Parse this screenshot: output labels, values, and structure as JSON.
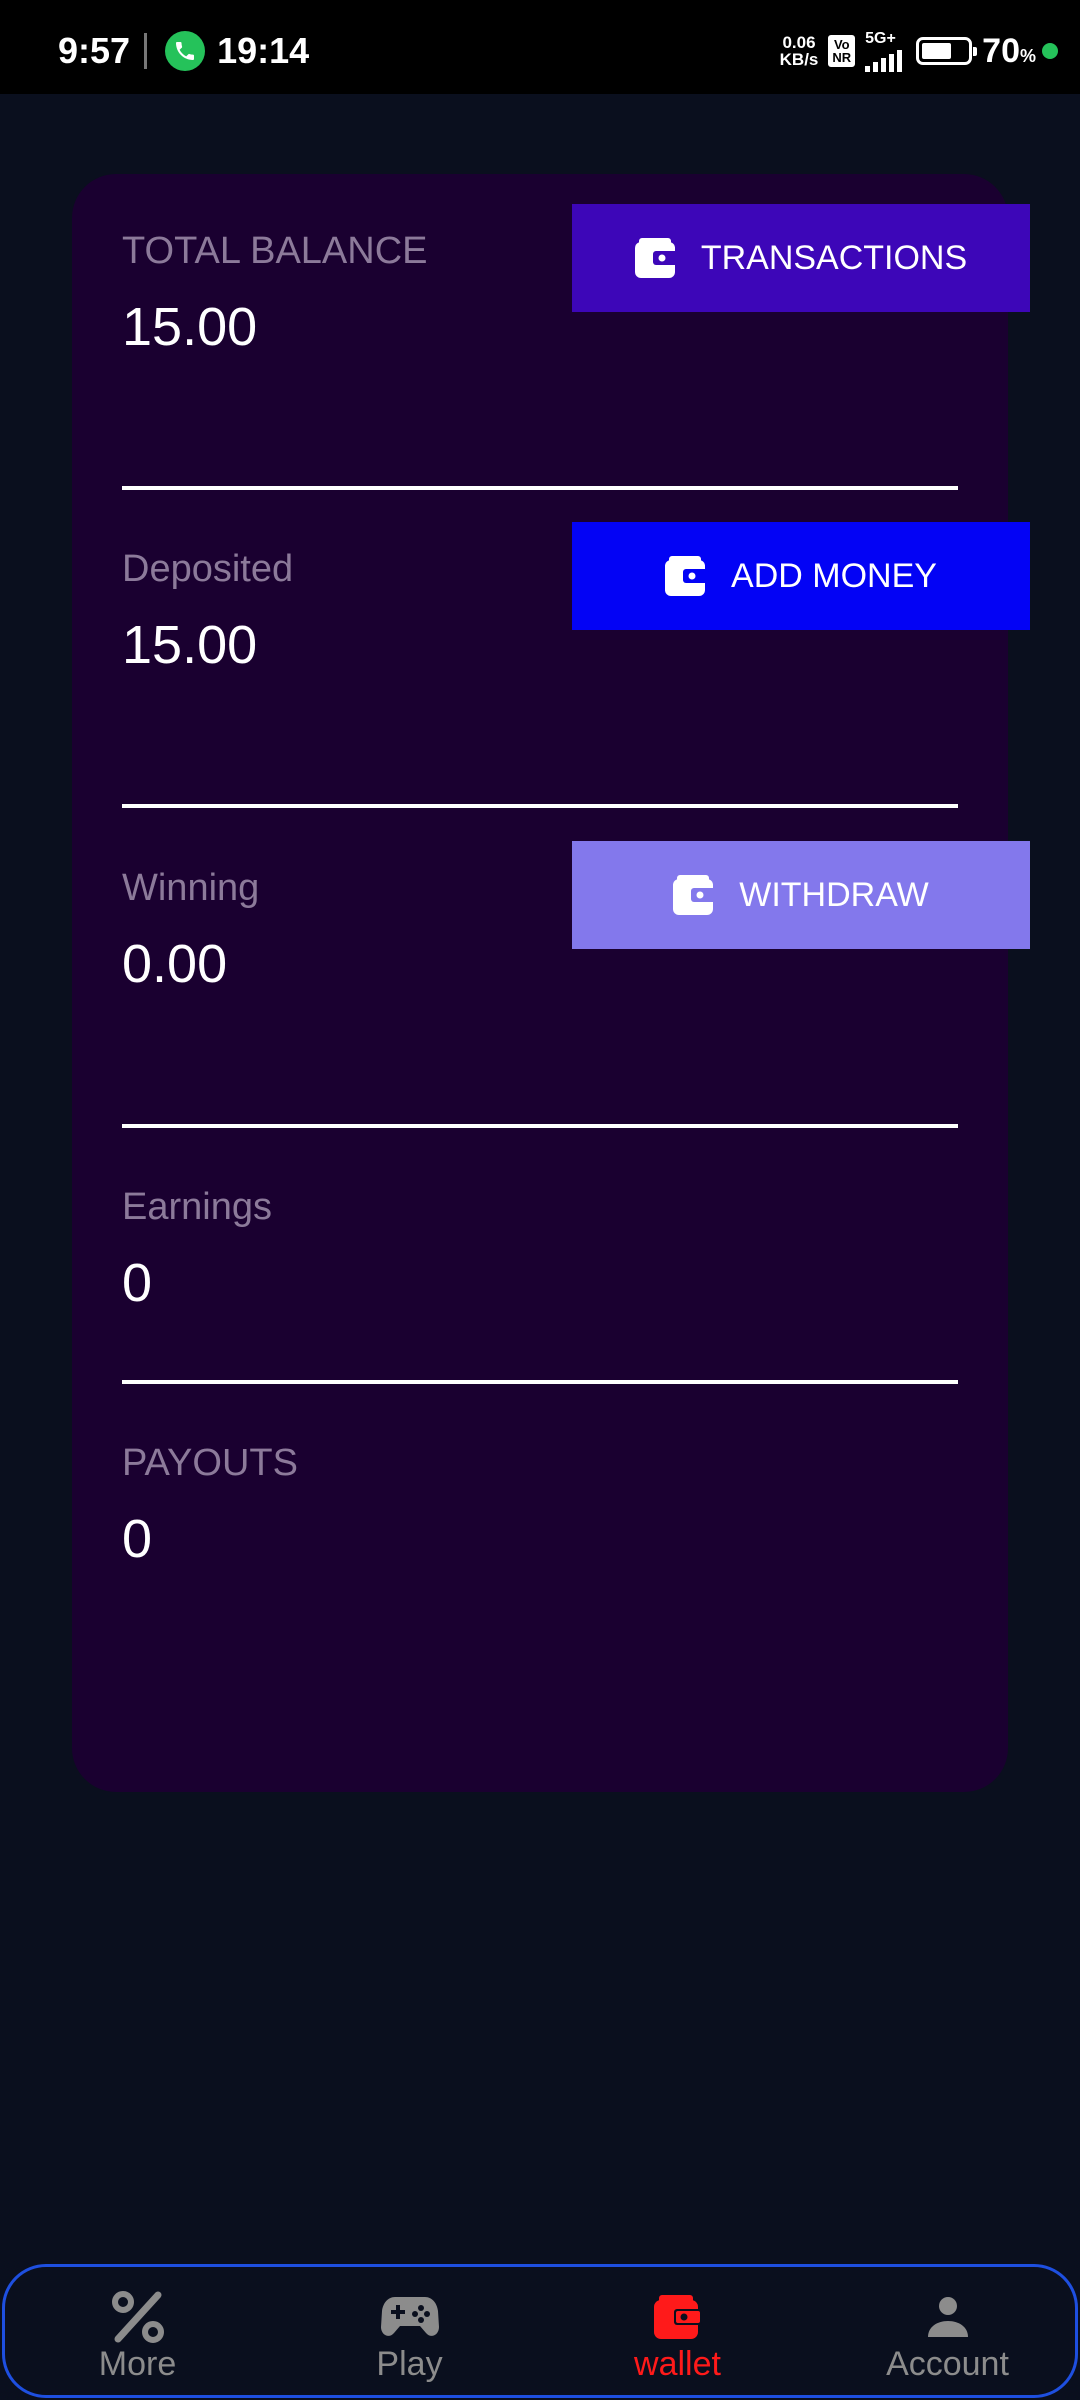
{
  "status_bar": {
    "clock": "9:57",
    "call_timer": "19:14",
    "speed_value": "0.06",
    "speed_unit": "KB/s",
    "volte_top": "Vo",
    "volte_bottom": "NR",
    "network": "5G+",
    "battery_percent": "70",
    "battery_unit": "%",
    "battery_level": 0.7
  },
  "wallet": {
    "sections": [
      {
        "label": "TOTAL BALANCE",
        "value": "15.00",
        "button_label": "TRANSACTIONS"
      },
      {
        "label": "Deposited",
        "value": "15.00",
        "button_label": "ADD MONEY"
      },
      {
        "label": "Winning",
        "value": "0.00",
        "button_label": "WITHDRAW"
      },
      {
        "label": "Earnings",
        "value": "0"
      },
      {
        "label": "PAYOUTS",
        "value": "0"
      }
    ]
  },
  "bottom_nav": {
    "items": [
      {
        "label": "More",
        "icon": "percent-icon"
      },
      {
        "label": "Play",
        "icon": "gamepad-icon"
      },
      {
        "label": "wallet",
        "icon": "wallet-icon",
        "active": true
      },
      {
        "label": "Account",
        "icon": "person-icon"
      }
    ]
  },
  "colors": {
    "background": "#0a0f1e",
    "card": "#1a0030",
    "transactions_button": "#3d06b8",
    "add_money_button": "#0303f5",
    "withdraw_button": "#8378ec",
    "active_nav": "#ff1a1a",
    "nav_border": "#1e4fe0"
  }
}
